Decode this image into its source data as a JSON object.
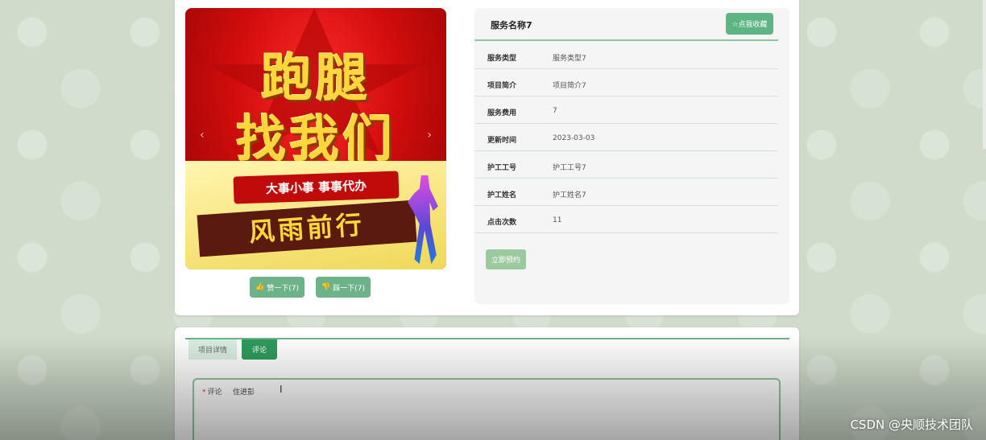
{
  "banner": {
    "line1": "跑腿",
    "line2": "找我们",
    "ribbon": "大事小事 事事代办",
    "slogan": "风雨前行",
    "prev_arrow": "‹",
    "next_arrow": "›"
  },
  "votes": {
    "up_label": "赞一下(7)",
    "down_label": "踩一下(7)"
  },
  "service": {
    "title": "服务名称7",
    "favorite_label": "☆点我收藏",
    "fields": [
      {
        "label": "服务类型",
        "value": "服务类型7"
      },
      {
        "label": "项目简介",
        "value": "项目简介7"
      },
      {
        "label": "服务费用",
        "value": "7"
      },
      {
        "label": "更新时间",
        "value": "2023-03-03"
      },
      {
        "label": "护工工号",
        "value": "护工工号7"
      },
      {
        "label": "护工姓名",
        "value": "护工姓名7"
      },
      {
        "label": "点击次数",
        "value": "11"
      }
    ],
    "book_label": "立即预约"
  },
  "tabs": [
    {
      "label": "项目详情"
    },
    {
      "label": "评论"
    }
  ],
  "comment": {
    "required_mark": "*",
    "label": "评论",
    "value": "住进彭"
  },
  "watermark": "CSDN @央顺技术团队",
  "colors": {
    "accent": "#5cb583",
    "active_tab": "#2f9a5c",
    "book_button": "#9cc99d"
  }
}
